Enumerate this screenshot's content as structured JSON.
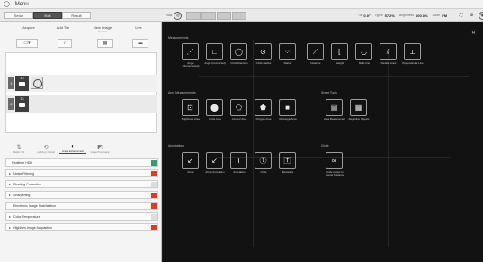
{
  "titlebar": {
    "menu": "Menu"
  },
  "modes": [
    "Setup",
    "Edit",
    "Result"
  ],
  "toolbar": {
    "items": [
      {
        "label": "Vals",
        "value": ""
      },
      {
        "label": "Tilt",
        "value": "0.0°"
      },
      {
        "label": "Types",
        "value": "57.2%"
      },
      {
        "label": "Brightness",
        "value": "100.0%"
      },
      {
        "label": "Zoom",
        "value": "FM"
      }
    ]
  },
  "sidebar": {
    "header": {
      "acquire": "Acquire",
      "add_tile": "Add Tile",
      "new_image": "New Image",
      "new_image_sub": "Overlay",
      "live": "Live"
    },
    "rows": [
      {
        "num": "1",
        "cam": "3D"
      },
      {
        "num": "2",
        "cam": "3D"
      }
    ],
    "funcs": [
      "Depth / 3D",
      "Lighting / Optical",
      "Image Enhancement",
      "Image Processing"
    ],
    "settings": [
      {
        "label": "Realtime HDR",
        "toggle": "green"
      },
      {
        "label": "Noise Filtering",
        "toggle": "red"
      },
      {
        "label": "Shading Correction",
        "toggle": "off"
      },
      {
        "label": "Sharpening",
        "toggle": "red"
      },
      {
        "label": "Electronic Image Stabilization",
        "toggle": "red"
      },
      {
        "label": "Color Temperature",
        "toggle": "off"
      },
      {
        "label": "Highlites Image Acquisition",
        "toggle": "red"
      }
    ]
  },
  "main": {
    "sections": {
      "measurements": "Measurements",
      "area_measurements": "Area Measurements",
      "smart_tools": "Smart Tools",
      "annotations": "Annotations",
      "circle": "Circle"
    },
    "tools": {
      "measure": [
        "Angle (Disconnected)",
        "Angle (Connected)",
        "Circle Diameter",
        "Circle Radius",
        "Marker",
        "Distance",
        "Height",
        "Multi Line",
        "Parallel Lines",
        "Perpendicular Line"
      ],
      "area": [
        "Brightness Area",
        "Circle Area",
        "Contour Area",
        "Polygon Area",
        "Rectangle Area"
      ],
      "smart": [
        "Area Measurement",
        "Repetitive Objects"
      ],
      "annot": [
        "Arrow",
        "Arrow Annotation",
        "Annotation",
        "Circle",
        "Rectangle"
      ],
      "circle": [
        "Circle Center to Center Distance"
      ]
    }
  }
}
